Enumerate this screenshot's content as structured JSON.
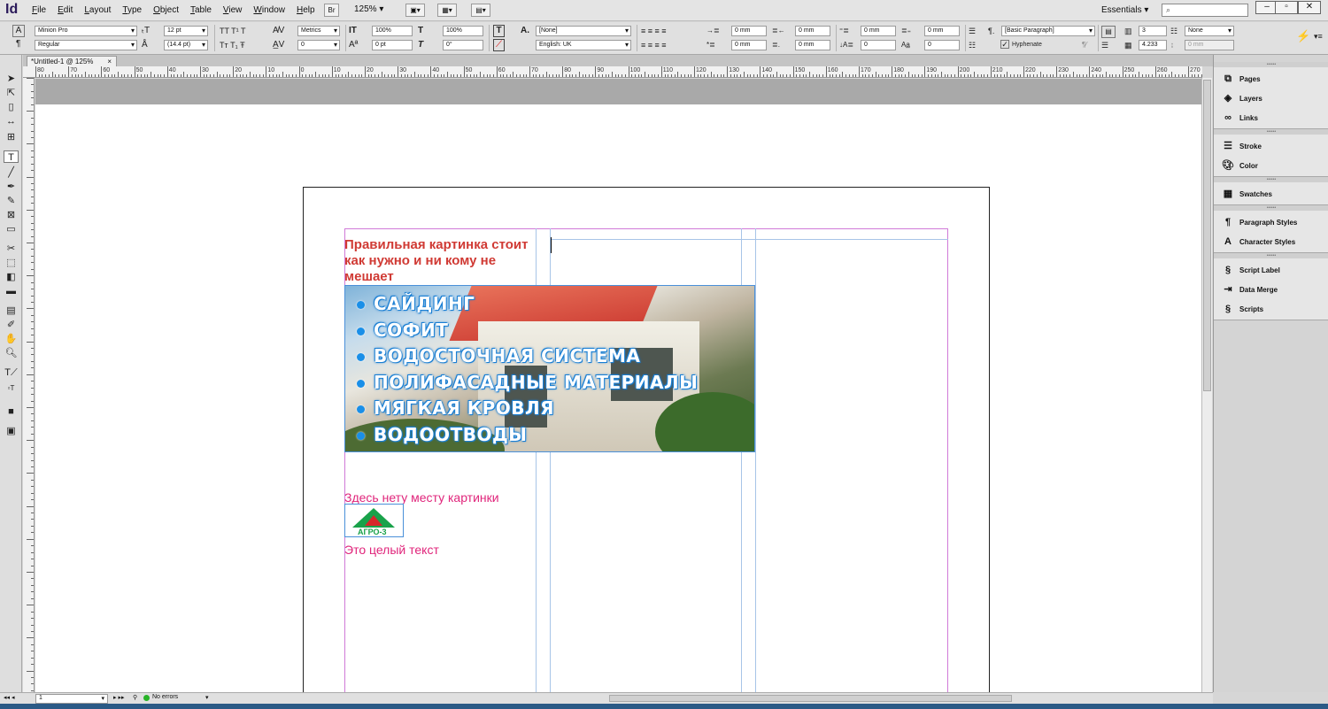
{
  "app": {
    "logo": "Id",
    "menu": [
      "File",
      "Edit",
      "Layout",
      "Type",
      "Object",
      "Table",
      "View",
      "Window",
      "Help"
    ],
    "bridge_label": "Br",
    "zoom": "125% ▾",
    "workspace": "Essentials ▾"
  },
  "control": {
    "font_family": "Minion Pro",
    "font_style": "Regular",
    "font_size": "12 pt",
    "leading": "(14.4 pt)",
    "kerning": "Metrics",
    "tracking": "0",
    "vscale": "100%",
    "hscale": "100%",
    "baseline": "0 pt",
    "skew": "0°",
    "char_style": "[None]",
    "language": "English: UK",
    "indent_left": "0 mm",
    "indent_right": "0 mm",
    "first_indent": "0 mm",
    "last_indent": "0 mm",
    "space_before": "0 mm",
    "space_after": "0 mm",
    "drop_lines": "0",
    "drop_chars": "0",
    "para_style": "[Basic Paragraph]",
    "hyphenate": "Hyphenate",
    "columns": "3",
    "gutter": "4.233",
    "span": "None",
    "span_width": "0 mm"
  },
  "document": {
    "tab_title": "*Untitled-1 @ 125%",
    "tab_close": "×",
    "ruler_labels": [
      "80",
      "70",
      "60",
      "50",
      "40",
      "30",
      "20",
      "10",
      "0",
      "10",
      "20",
      "30",
      "40",
      "50",
      "60",
      "70",
      "80",
      "90",
      "100",
      "110",
      "120",
      "130",
      "140",
      "150",
      "160",
      "170",
      "180",
      "190",
      "200",
      "210",
      "220",
      "230",
      "240",
      "250",
      "260",
      "270"
    ]
  },
  "content": {
    "heading": "Правильная картинка стоит как нужно и ни кому не мешает",
    "banner_items": [
      "САЙДИНГ",
      "СОФИТ",
      "ВОДОСТОЧНАЯ СИСТЕМА",
      "ПОЛИФАСАДНЫЕ МАТЕРИАЛЫ",
      "МЯГКАЯ КРОВЛЯ",
      "ВОДООТВОДЫ"
    ],
    "note": "Здесь нету месту картинки",
    "logo_text": "АГРО-3",
    "body": "Это целый текст"
  },
  "panels": {
    "group1": [
      "Pages",
      "Layers",
      "Links"
    ],
    "group2": [
      "Stroke",
      "Color"
    ],
    "group3": [
      "Swatches"
    ],
    "group4": [
      "Paragraph Styles",
      "Character Styles"
    ],
    "group5": [
      "Script Label",
      "Data Merge",
      "Scripts"
    ]
  },
  "status": {
    "page": "1",
    "preflight": "No errors"
  },
  "colors": {
    "heading": "#d03a34",
    "pink": "#e0257b",
    "guide": "#a7c4e7",
    "margin": "#d07ad8"
  }
}
